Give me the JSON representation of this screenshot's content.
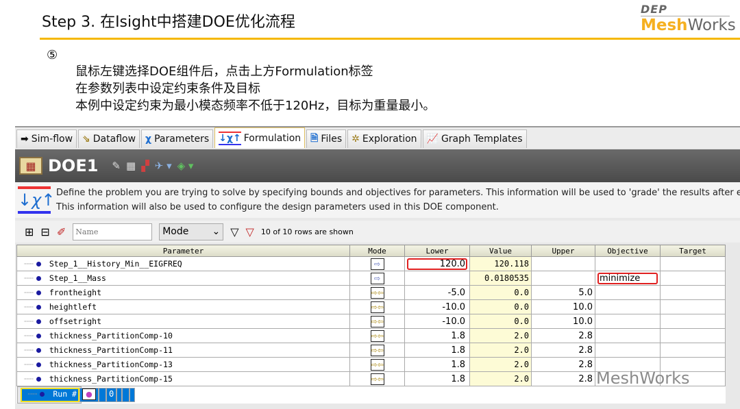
{
  "slide": {
    "title": "Step 3. 在Isight中搭建DOE优化流程",
    "step_marker": "⑤",
    "lines": [
      "鼠标左键选择DOE组件后，点击上方Formulation标签",
      "在参数列表中设定约束条件及目标",
      "本例中设定约束为最小模态频率不低于120Hz，目标为重量最小。"
    ],
    "logo": {
      "top": "DEP",
      "mesh": "Mesh",
      "works": "Works"
    },
    "watermark": "MeshWorks"
  },
  "tabs": [
    {
      "label": "Sim-flow",
      "icon": "arrow-right-icon"
    },
    {
      "label": "Dataflow",
      "icon": "dataflow-icon"
    },
    {
      "label": "Parameters",
      "icon": "parameters-icon"
    },
    {
      "label": "Formulation",
      "icon": "formulation-icon",
      "active": true
    },
    {
      "label": "Files",
      "icon": "files-icon"
    },
    {
      "label": "Exploration",
      "icon": "exploration-icon"
    },
    {
      "label": "Graph Templates",
      "icon": "graph-icon"
    }
  ],
  "component": {
    "name": "DOE1"
  },
  "info": {
    "line1": "Define the problem you are trying to solve by specifying bounds and objectives for parameters.  This information will be used to 'grade' the results after ex",
    "line2": "This information will also be used to configure the design parameters used in this DOE component."
  },
  "filter": {
    "name_placeholder": "Name",
    "mode_value": "Mode",
    "rows_shown": "10 of 10 rows are shown"
  },
  "table": {
    "headers": [
      "Parameter",
      "Mode",
      "Lower",
      "Value",
      "Upper",
      "Objective",
      "Target"
    ],
    "rows": [
      {
        "name": "Step_1__History_Min__EIGFREQ",
        "mode": "output",
        "lower": "120.0",
        "value": "120.118",
        "upper": "",
        "objective": "",
        "target": ""
      },
      {
        "name": "Step_1__Mass",
        "mode": "output",
        "lower": "",
        "value": "0.0180535",
        "upper": "",
        "objective": "minimize",
        "target": ""
      },
      {
        "name": "frontheight",
        "mode": "input-output",
        "lower": "-5.0",
        "value": "0.0",
        "upper": "5.0",
        "objective": "",
        "target": ""
      },
      {
        "name": "heightleft",
        "mode": "input-output",
        "lower": "-10.0",
        "value": "0.0",
        "upper": "10.0",
        "objective": "",
        "target": ""
      },
      {
        "name": "offsetright",
        "mode": "input-output",
        "lower": "-10.0",
        "value": "0.0",
        "upper": "10.0",
        "objective": "",
        "target": ""
      },
      {
        "name": "thickness_PartitionComp-10",
        "mode": "input-output",
        "lower": "1.8",
        "value": "2.0",
        "upper": "2.8",
        "objective": "",
        "target": ""
      },
      {
        "name": "thickness_PartitionComp-11",
        "mode": "input-output",
        "lower": "1.8",
        "value": "2.0",
        "upper": "2.8",
        "objective": "",
        "target": ""
      },
      {
        "name": "thickness_PartitionComp-13",
        "mode": "input-output",
        "lower": "1.8",
        "value": "2.0",
        "upper": "2.8",
        "objective": "",
        "target": ""
      },
      {
        "name": "thickness_PartitionComp-15",
        "mode": "input-output",
        "lower": "1.8",
        "value": "2.0",
        "upper": "2.8",
        "objective": "",
        "target": ""
      },
      {
        "name": "Run #",
        "mode": "local",
        "lower": "",
        "value": "0",
        "upper": "",
        "objective": "",
        "target": "",
        "selected": true
      }
    ]
  },
  "colors": {
    "accent": "#f5b800",
    "selection": "#0078d7",
    "highlight": "#e02020",
    "value_bg": "#fdfbd6"
  }
}
